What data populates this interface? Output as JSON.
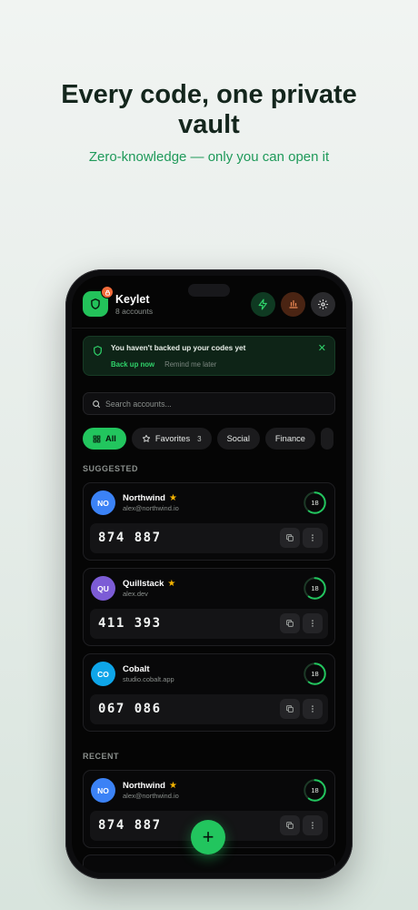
{
  "marketing": {
    "headline": "Every code, one private vault",
    "subheadline": "Zero-knowledge — only you can open it"
  },
  "app": {
    "name": "Keylet",
    "account_count": "8 accounts",
    "badge_icon": "lock-icon",
    "actions": [
      "bolt-icon",
      "bar-chart-icon",
      "gear-icon"
    ]
  },
  "banner": {
    "message": "You haven't backed up your codes yet",
    "primary_action": "Back up now",
    "secondary_action": "Remind me later"
  },
  "search": {
    "placeholder": "Search accounts..."
  },
  "filters": [
    {
      "label": "All",
      "active": true
    },
    {
      "label": "Favorites",
      "count": "3"
    },
    {
      "label": "Social"
    },
    {
      "label": "Finance"
    }
  ],
  "sections": {
    "suggested": "SUGGESTED",
    "recent": "RECENT"
  },
  "accounts": {
    "suggested": [
      {
        "initials": "NO",
        "name": "Northwind",
        "email": "alex@northwind.io",
        "favorite": true,
        "code": "874 887",
        "seconds": "18",
        "color": "#3b82f6"
      },
      {
        "initials": "QU",
        "name": "Quillstack",
        "email": "alex.dev",
        "favorite": true,
        "code": "411 393",
        "seconds": "18",
        "color": "#7c5cd6"
      },
      {
        "initials": "CO",
        "name": "Cobalt",
        "email": "studio.cobalt.app",
        "favorite": false,
        "code": "067 086",
        "seconds": "18",
        "color": "#0ea5e9"
      }
    ],
    "recent": [
      {
        "initials": "NO",
        "name": "Northwind",
        "email": "alex@northwind.io",
        "favorite": true,
        "code": "874 887",
        "seconds": "18",
        "color": "#3b82f6"
      }
    ]
  },
  "fab_label": "+",
  "accent": "#22c55e"
}
